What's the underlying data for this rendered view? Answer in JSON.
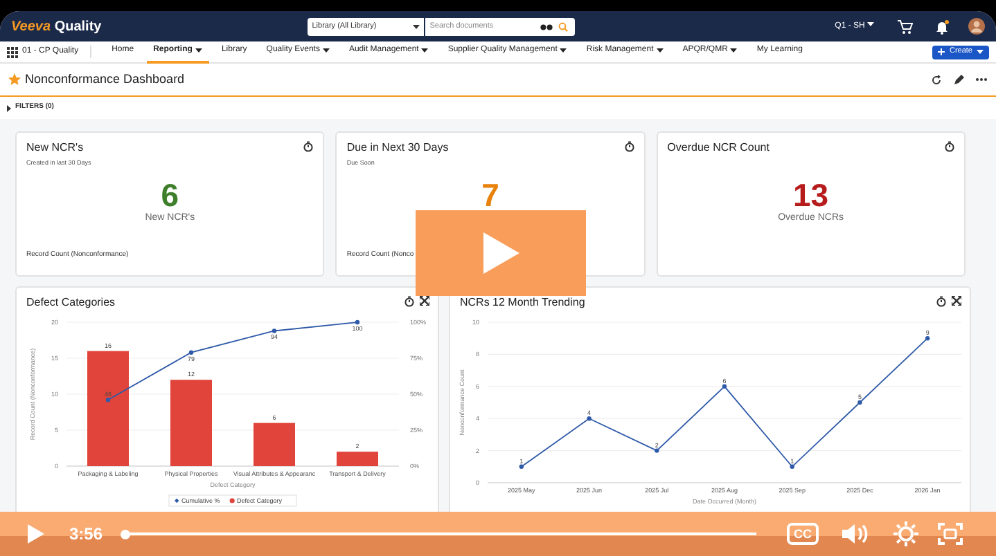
{
  "header": {
    "logo": {
      "brand": "Veeva",
      "product": "Quality"
    },
    "search": {
      "scope": "Library (All Library)",
      "placeholder": "Search documents"
    },
    "user_menu": "Q1 - SH"
  },
  "nav": {
    "vault": "01 - CP Quality",
    "tabs": [
      {
        "label": "Home",
        "dropdown": false,
        "selected": false
      },
      {
        "label": "Reporting",
        "dropdown": true,
        "selected": true
      },
      {
        "label": "Library",
        "dropdown": false,
        "selected": false
      },
      {
        "label": "Quality Events",
        "dropdown": true,
        "selected": false
      },
      {
        "label": "Audit Management",
        "dropdown": true,
        "selected": false
      },
      {
        "label": "Supplier Quality Management",
        "dropdown": true,
        "selected": false
      },
      {
        "label": "Risk Management",
        "dropdown": true,
        "selected": false
      },
      {
        "label": "APQR/QMR",
        "dropdown": true,
        "selected": false
      },
      {
        "label": "My Learning",
        "dropdown": false,
        "selected": false
      }
    ],
    "create_button": "Create"
  },
  "page": {
    "title": "Nonconformance Dashboard",
    "favorite": true,
    "filters": "FILTERS (0)"
  },
  "cards": [
    {
      "title": "New NCR's",
      "subtitle": "Created in last 30 Days",
      "value": "6",
      "color": "#3f7f2b",
      "caption": "New NCR's",
      "footer": "Record Count (Nonconformance)"
    },
    {
      "title": "Due in Next 30 Days",
      "subtitle": "Due Soon",
      "value": "7",
      "color": "#e8820c",
      "footer": "Record Count (Nonco"
    },
    {
      "title": "Overdue NCR Count",
      "value": "13",
      "color": "#b71c1c",
      "caption": "Overdue NCRs"
    }
  ],
  "charts": [
    {
      "title": "Defect Categories",
      "chart_data": {
        "type": "bar",
        "xlabel": "Defect Category",
        "ylabel": "Record Count (Nonconformance)",
        "categories": [
          "Packaging & Labeling",
          "Physical Properties",
          "Visual Attributes & Appearanc",
          "Transport & Delivery"
        ],
        "series": [
          {
            "name": "Cumulative %",
            "type": "line",
            "axis": "y2",
            "marker": "circle",
            "color": "#2f5aa8",
            "values": [
              46,
              79,
              94,
              100
            ]
          },
          {
            "name": "Defect Category",
            "type": "bar",
            "color": "#e0443a",
            "values": [
              16,
              12,
              6,
              2
            ]
          }
        ],
        "ylim": [
          0,
          20
        ],
        "yticks": [
          0,
          5,
          10,
          15,
          20
        ],
        "y2lim": [
          0,
          100
        ],
        "y2ticks": [
          {
            "value": 0,
            "label": "0%"
          },
          {
            "value": 25,
            "label": "25%"
          },
          {
            "value": 50,
            "label": "50%"
          },
          {
            "value": 75,
            "label": "75%"
          },
          {
            "value": 100,
            "label": "100%"
          }
        ],
        "grid": true,
        "legend": "bottom",
        "data_labels": true
      }
    },
    {
      "title": "NCRs 12 Month Trending",
      "chart_data": {
        "type": "line",
        "xlabel": "Date Occurred (Month)",
        "ylabel": "Nonconformance Count",
        "categories": [
          "2025 May",
          "2025 Jun",
          "2025 Jul",
          "2025 Aug",
          "2025 Sep",
          "2025 Dec",
          "2026 Jan"
        ],
        "series": [
          {
            "marker": "circle",
            "color": "#2f5aa8",
            "values": [
              1,
              4,
              2,
              6,
              1,
              5,
              9
            ]
          }
        ],
        "ylim": [
          0,
          10
        ],
        "yticks": [
          0,
          2,
          4,
          6,
          8,
          10
        ],
        "grid": true,
        "data_labels": true
      }
    }
  ],
  "player": {
    "time": "3:56",
    "level": 0,
    "captions_label": "CC"
  }
}
